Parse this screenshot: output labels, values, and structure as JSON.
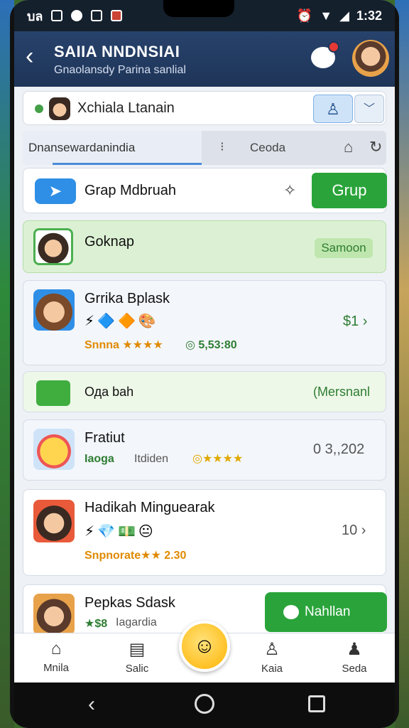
{
  "status": {
    "time": "1:32",
    "left_text": "บล"
  },
  "header": {
    "title": "SAIIA NNDNSIAI",
    "subtitle": "Gnaolansdy Parina sanlial"
  },
  "search": {
    "text": "Xchiala Ltanain"
  },
  "tabs": {
    "tab1": "Dnansewardanindia",
    "tab2": "Ceoda"
  },
  "cards": [
    {
      "label": "Grap Mdbruah",
      "button": "Grup"
    },
    {
      "label": "Goknap",
      "badge": "Samoon"
    },
    {
      "name": "Grrika Bplask",
      "sub": "Snnna ★★★★",
      "sub2": "◎ 5,53:80",
      "value": "$1 ›"
    },
    {
      "label": "Ода bah",
      "value": "(Mersnanl"
    },
    {
      "name": "Fratiut",
      "sub": "Iaoga",
      "sub2": "Itdiden",
      "stars": "◎★★★★",
      "value": "0 3,,202"
    },
    {
      "name": "Hadikah Minguearak",
      "sub": "Snpnorate★★ 2.30",
      "value": "10 ›"
    },
    {
      "name": "Pepkas Sdask",
      "sub": "★$8",
      "sub2": "Iagardia",
      "button": "Nahllan"
    }
  ],
  "bottom_nav": [
    "Mnila",
    "Salic",
    "Kaia",
    "Seda"
  ],
  "colors": {
    "header": "#27426c",
    "accent_green": "#2aa43a",
    "accent_blue": "#2f8fe6"
  }
}
